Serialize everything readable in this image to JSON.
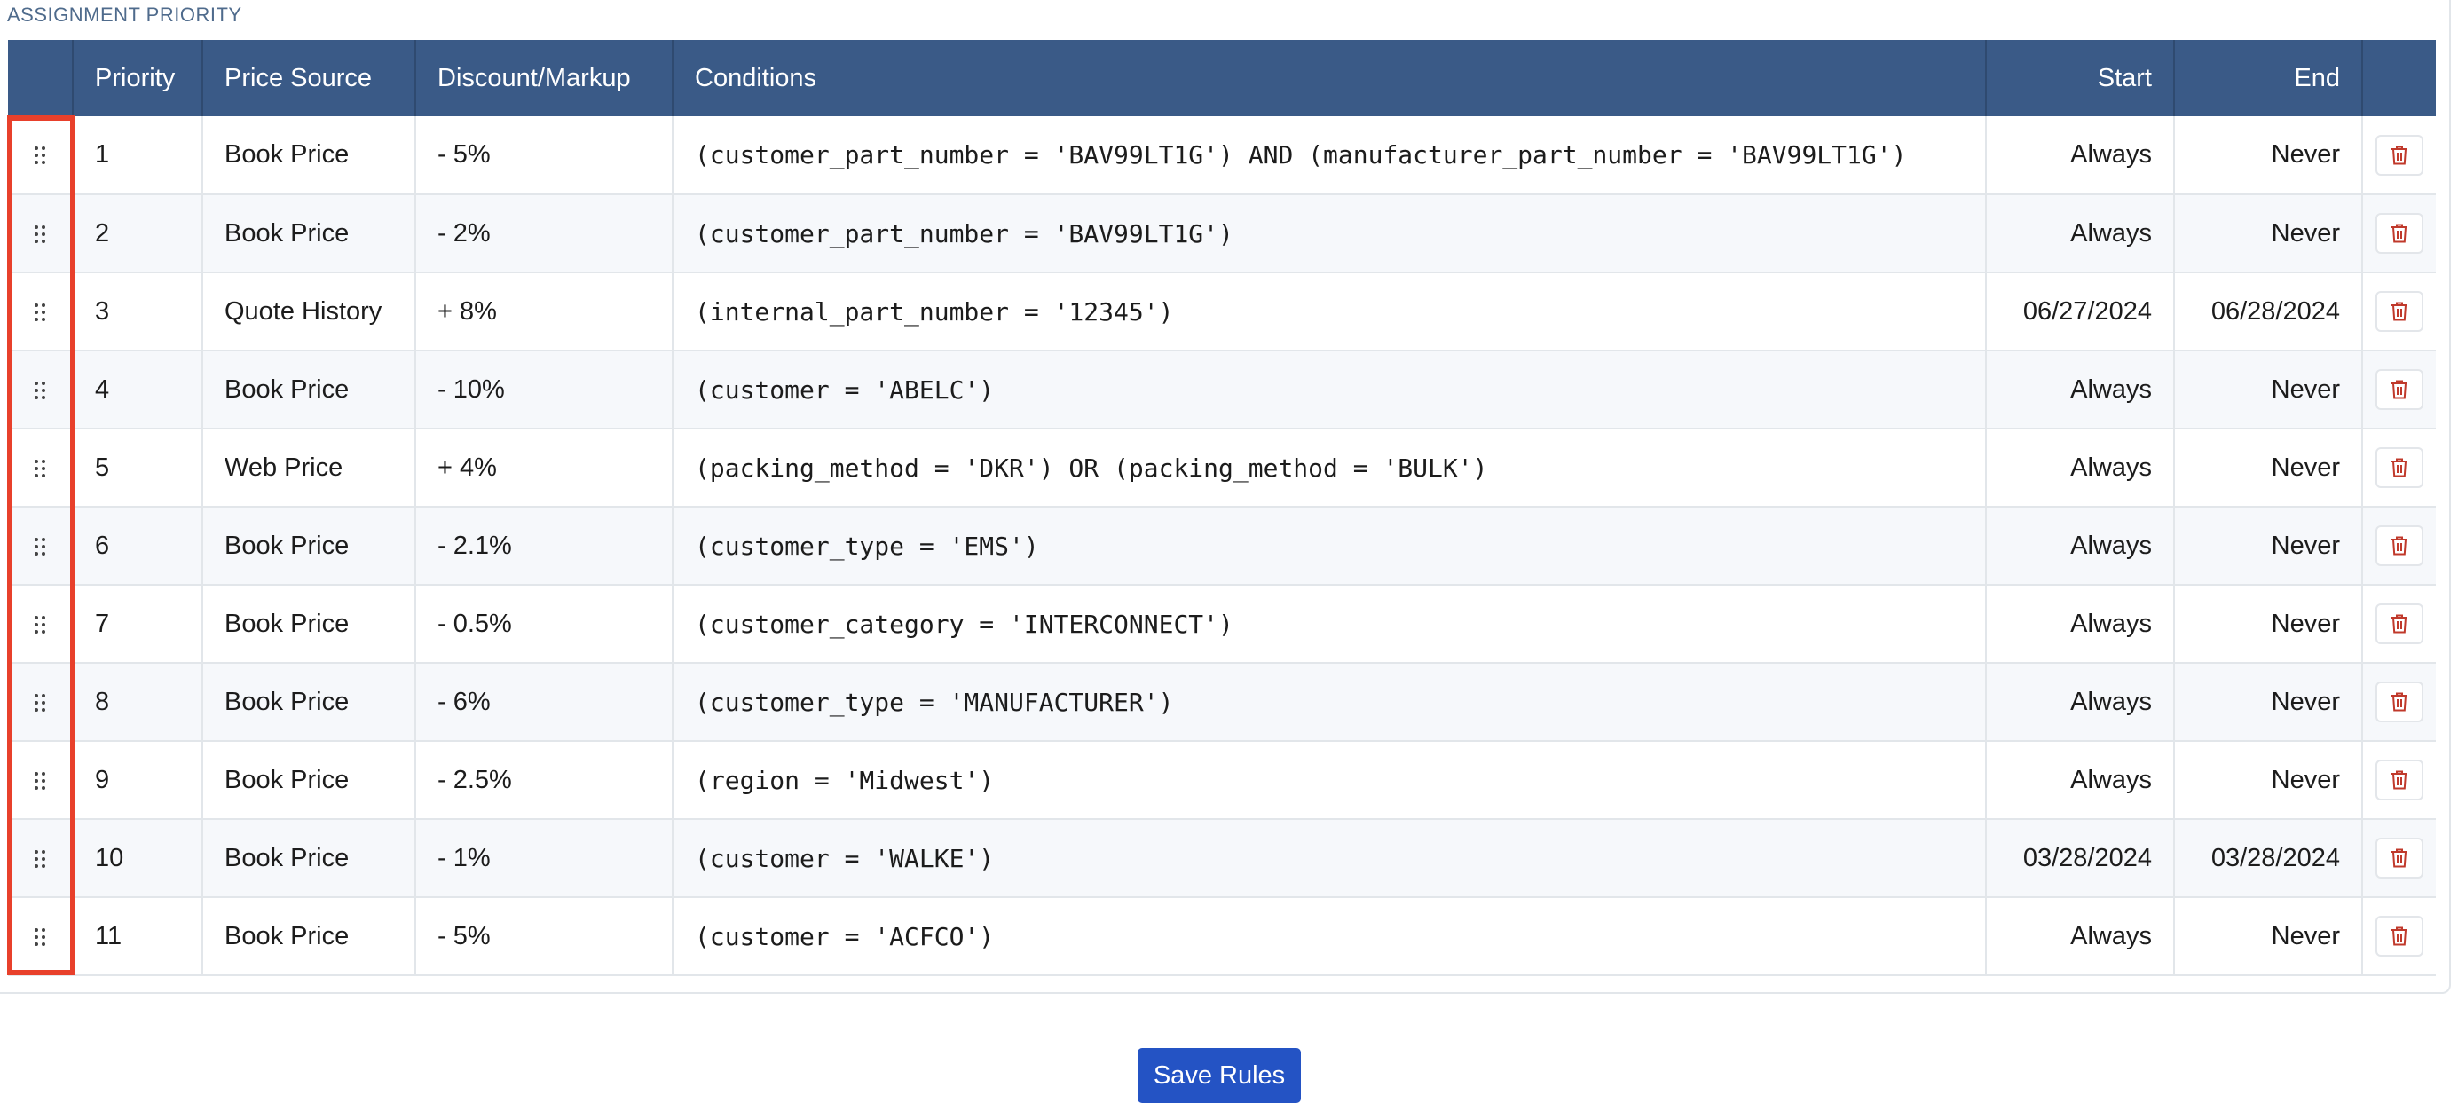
{
  "section_label": "ASSIGNMENT PRIORITY",
  "columns": {
    "handle": "",
    "priority": "Priority",
    "source": "Price Source",
    "discount": "Discount/Markup",
    "conditions": "Conditions",
    "start": "Start",
    "end": "End",
    "actions": ""
  },
  "rows": [
    {
      "priority": "1",
      "source": "Book Price",
      "discount": "- 5%",
      "conditions": "(customer_part_number = 'BAV99LT1G') AND (manufacturer_part_number = 'BAV99LT1G')",
      "start": "Always",
      "end": "Never"
    },
    {
      "priority": "2",
      "source": "Book Price",
      "discount": "- 2%",
      "conditions": "(customer_part_number = 'BAV99LT1G')",
      "start": "Always",
      "end": "Never"
    },
    {
      "priority": "3",
      "source": "Quote History",
      "discount": "+ 8%",
      "conditions": "(internal_part_number = '12345')",
      "start": "06/27/2024",
      "end": "06/28/2024"
    },
    {
      "priority": "4",
      "source": "Book Price",
      "discount": "- 10%",
      "conditions": "(customer = 'ABELC')",
      "start": "Always",
      "end": "Never"
    },
    {
      "priority": "5",
      "source": "Web Price",
      "discount": "+ 4%",
      "conditions": "(packing_method = 'DKR') OR (packing_method = 'BULK')",
      "start": "Always",
      "end": "Never"
    },
    {
      "priority": "6",
      "source": "Book Price",
      "discount": "- 2.1%",
      "conditions": "(customer_type = 'EMS')",
      "start": "Always",
      "end": "Never"
    },
    {
      "priority": "7",
      "source": "Book Price",
      "discount": "- 0.5%",
      "conditions": "(customer_category = 'INTERCONNECT')",
      "start": "Always",
      "end": "Never"
    },
    {
      "priority": "8",
      "source": "Book Price",
      "discount": "- 6%",
      "conditions": "(customer_type = 'MANUFACTURER')",
      "start": "Always",
      "end": "Never"
    },
    {
      "priority": "9",
      "source": "Book Price",
      "discount": "- 2.5%",
      "conditions": "(region = 'Midwest')",
      "start": "Always",
      "end": "Never"
    },
    {
      "priority": "10",
      "source": "Book Price",
      "discount": "- 1%",
      "conditions": "(customer = 'WALKE')",
      "start": "03/28/2024",
      "end": "03/28/2024"
    },
    {
      "priority": "11",
      "source": "Book Price",
      "discount": "- 5%",
      "conditions": "(customer = 'ACFCO')",
      "start": "Always",
      "end": "Never"
    }
  ],
  "icons": {
    "drag": "drag-handle-icon",
    "delete": "trash-icon"
  },
  "colors": {
    "header_bg": "#3a5a87",
    "delete_icon": "#c0392b",
    "save_button": "#2453c4",
    "highlight": "#e8402b"
  },
  "save_label": "Save Rules"
}
